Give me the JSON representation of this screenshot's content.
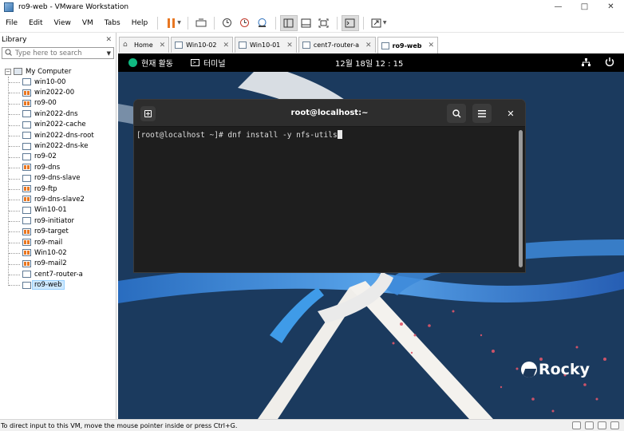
{
  "window": {
    "title": "ro9-web - VMware Workstation"
  },
  "menu": [
    "File",
    "Edit",
    "View",
    "VM",
    "Tabs",
    "Help"
  ],
  "library": {
    "title": "Library",
    "search_placeholder": "Type here to search",
    "root": "My Computer",
    "items": [
      {
        "label": "win10-00",
        "running": false
      },
      {
        "label": "win2022-00",
        "running": true
      },
      {
        "label": "ro9-00",
        "running": true
      },
      {
        "label": "win2022-dns",
        "running": false
      },
      {
        "label": "win2022-cache",
        "running": false
      },
      {
        "label": "win2022-dns-root",
        "running": false
      },
      {
        "label": "win2022-dns-ke",
        "running": false
      },
      {
        "label": "ro9-02",
        "running": false
      },
      {
        "label": "ro9-dns",
        "running": true
      },
      {
        "label": "ro9-dns-slave",
        "running": false
      },
      {
        "label": "ro9-ftp",
        "running": true
      },
      {
        "label": "ro9-dns-slave2",
        "running": true
      },
      {
        "label": "Win10-01",
        "running": false
      },
      {
        "label": "ro9-initiator",
        "running": false
      },
      {
        "label": "ro9-target",
        "running": true
      },
      {
        "label": "ro9-mail",
        "running": true
      },
      {
        "label": "Win10-02",
        "running": true
      },
      {
        "label": "ro9-mail2",
        "running": true
      },
      {
        "label": "cent7-router-a",
        "running": false
      },
      {
        "label": "ro9-web",
        "running": false,
        "selected": true
      }
    ]
  },
  "tabs": [
    {
      "label": "Home",
      "active": false
    },
    {
      "label": "Win10-02",
      "active": false
    },
    {
      "label": "Win10-01",
      "active": false
    },
    {
      "label": "cent7-router-a",
      "active": false
    },
    {
      "label": "ro9-web",
      "active": true
    }
  ],
  "gnome": {
    "activities": "현재 활동",
    "app": "터미널",
    "clock": "12월 18일  12 : 15"
  },
  "terminal": {
    "title": "root@localhost:~",
    "prompt": "[root@localhost ~]# ",
    "command": "dnf install -y nfs-utils"
  },
  "wallpaper": {
    "brand": "Rocky"
  },
  "status": {
    "text": "To direct input to this VM, move the mouse pointer inside or press Ctrl+G."
  },
  "colors": {
    "accent": "#e87722",
    "vm_bg": "#1a3658",
    "terminal_bg": "#1e1e1e"
  }
}
